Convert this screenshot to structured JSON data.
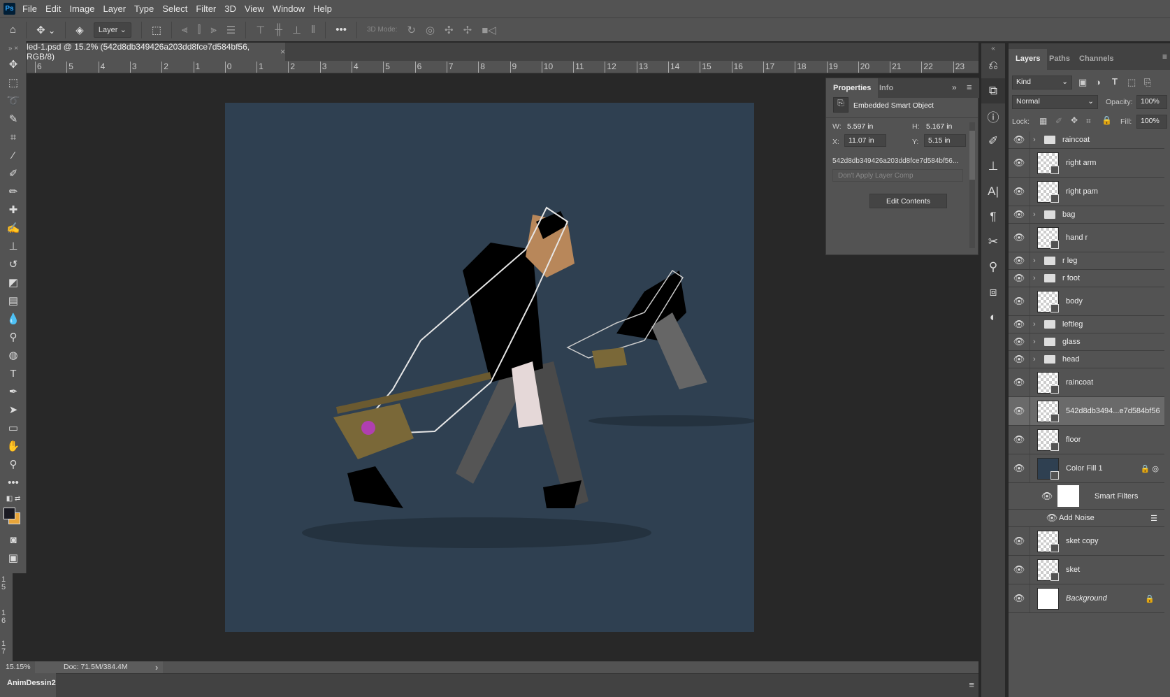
{
  "app": {
    "logo": "Ps"
  },
  "menu": [
    "File",
    "Edit",
    "Image",
    "Layer",
    "Type",
    "Select",
    "Filter",
    "3D",
    "View",
    "Window",
    "Help"
  ],
  "options": {
    "layer_select": "Layer",
    "mode_label": "3D Mode:",
    "more": "•••"
  },
  "document": {
    "tab_title": "led-1.psd @ 15.2% (542d8db349426a203dd8fce7d584bf56, RGB/8)",
    "close": "×"
  },
  "ruler": {
    "ticks": [
      "6",
      "5",
      "4",
      "3",
      "2",
      "1",
      "0",
      "1",
      "2",
      "3",
      "4",
      "5",
      "6",
      "7",
      "8",
      "9",
      "10",
      "11",
      "12",
      "13",
      "14",
      "15",
      "16",
      "17",
      "18",
      "19",
      "20",
      "21",
      "22",
      "23"
    ],
    "vticks": [
      "1 5",
      "1 6",
      "1 7"
    ]
  },
  "status": {
    "zoom": "15.15%",
    "doc": "Doc: 71.5M/384.4M",
    "arrow": "›"
  },
  "bottom_panel": {
    "tab": "AnimDessin2"
  },
  "properties": {
    "tabs": [
      "Properties",
      "Info"
    ],
    "type": "Embedded Smart Object",
    "w_label": "W:",
    "w": "5.597 in",
    "h_label": "H:",
    "h": "5.167 in",
    "x_label": "X:",
    "x": "11.07 in",
    "y_label": "Y:",
    "y": "5.15 in",
    "filename": "542d8db349426a203dd8fce7d584bf56...",
    "layer_comp": "Don't Apply Layer Comp",
    "edit_button": "Edit Contents"
  },
  "layers_panel": {
    "tabs": [
      "Layers",
      "Paths",
      "Channels"
    ],
    "filter": "Kind",
    "blend": "Normal",
    "opacity_label": "Opacity:",
    "opacity": "100%",
    "lock_label": "Lock:",
    "fill_label": "Fill:",
    "fill": "100%",
    "layers": [
      {
        "name": "raincoat",
        "kind": "group"
      },
      {
        "name": "right arm",
        "kind": "layer"
      },
      {
        "name": "right pam",
        "kind": "layer"
      },
      {
        "name": "bag",
        "kind": "group"
      },
      {
        "name": "hand r",
        "kind": "layer"
      },
      {
        "name": "r leg",
        "kind": "group"
      },
      {
        "name": "r foot",
        "kind": "group"
      },
      {
        "name": "body",
        "kind": "layer"
      },
      {
        "name": "leftleg",
        "kind": "group"
      },
      {
        "name": "glass",
        "kind": "group"
      },
      {
        "name": "head",
        "kind": "group"
      },
      {
        "name": "raincoat",
        "kind": "layer"
      },
      {
        "name": "542d8db3494...e7d584bf56",
        "kind": "layer",
        "selected": true
      },
      {
        "name": "floor",
        "kind": "layer"
      },
      {
        "name": "Color Fill 1",
        "kind": "fill",
        "color": "#2f4051"
      },
      {
        "name": "Smart Filters",
        "kind": "smartfilters"
      },
      {
        "name": "Add Noise",
        "kind": "filter"
      },
      {
        "name": "sket copy",
        "kind": "layer"
      },
      {
        "name": "sket",
        "kind": "layer"
      },
      {
        "name": "Background",
        "kind": "background"
      }
    ]
  },
  "colors": {
    "canvas_bg": "#2f4051",
    "foreground": "#1a1a22",
    "background": "#e8a53a"
  }
}
